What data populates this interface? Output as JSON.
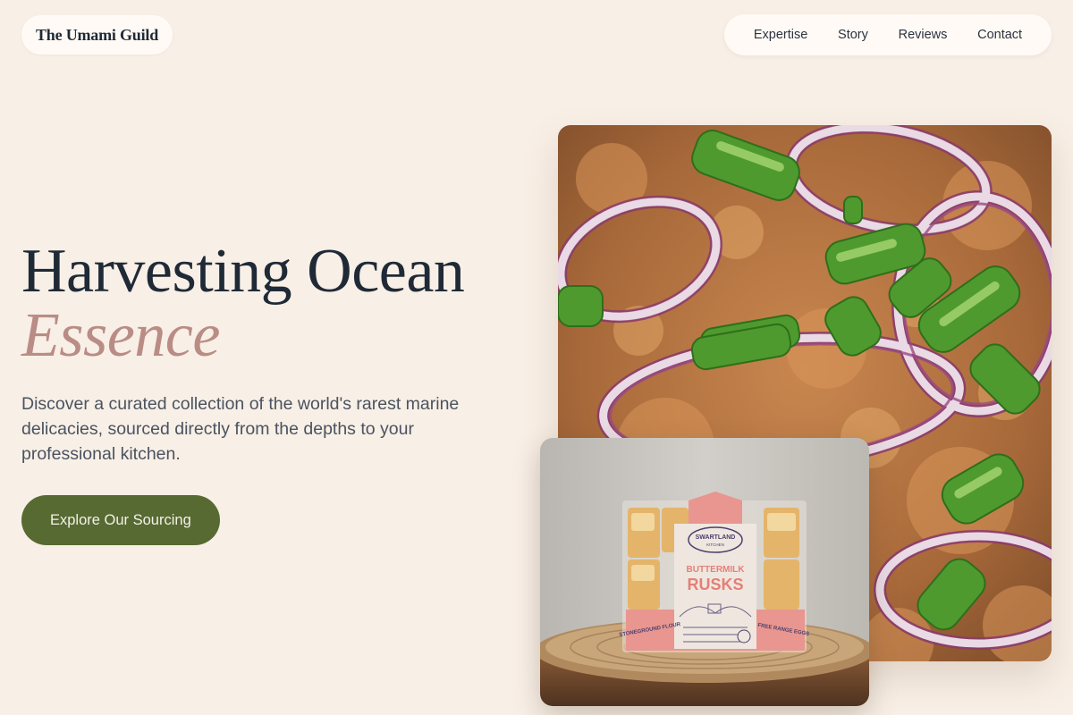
{
  "header": {
    "brand": "The Umami Guild",
    "nav": [
      "Expertise",
      "Story",
      "Reviews",
      "Contact"
    ]
  },
  "hero": {
    "title_line1": "Harvesting Ocean",
    "title_accent": "Essence",
    "description": "Discover a curated collection of the world's rarest marine delicacies, sourced directly from the depths to your professional kitchen.",
    "cta_label": "Explore Our Sourcing"
  },
  "images": {
    "main_alt": "Close-up of a dish topped with red onion rings and green onion",
    "secondary_alt": "Packet of Swartland Kitchen Buttermilk Rusks on a woven mat",
    "package": {
      "brand_top": "SWARTLAND",
      "brand_bottom": "KITCHEN",
      "product_line1": "BUTTERMILK",
      "product_line2": "RUSKS",
      "left_tag": "STONEGROUND FLOUR",
      "right_tag": "FREE RANGE EGGS"
    }
  },
  "colors": {
    "background": "#f8efe6",
    "accent": "#b98c85",
    "cta": "#566a32",
    "text": "#1f2a36"
  }
}
